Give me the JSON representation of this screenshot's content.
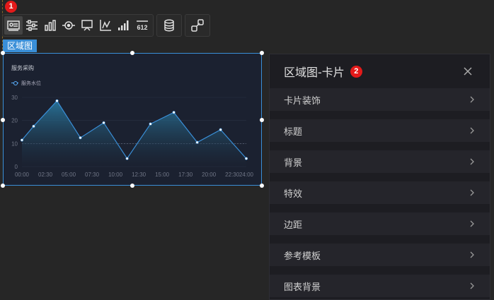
{
  "toolbar": {
    "groups": [
      [
        "image-chart-icon",
        "sliders-icon",
        "bar-chart-icon",
        "target-icon",
        "flag-icon",
        "axis-icon",
        "signal-bars-icon",
        "number-icon"
      ],
      [
        "database-icon"
      ],
      [
        "link-icon"
      ]
    ],
    "number_icon_text": "612"
  },
  "badges": {
    "one": "1",
    "two": "2"
  },
  "component_label": "区域图",
  "widget": {
    "title": "服务采购",
    "legend": "服务水位"
  },
  "chart_data": {
    "type": "area",
    "x": [
      "00:00",
      "02:30",
      "05:00",
      "07:30",
      "10:00",
      "12:30",
      "15:00",
      "17:30",
      "20:00",
      "22:30",
      "24:00"
    ],
    "points": [
      {
        "x": "00:00",
        "y": 11.5
      },
      {
        "x": "01:15",
        "y": 17.5
      },
      {
        "x": "03:45",
        "y": 28.5
      },
      {
        "x": "06:15",
        "y": 12.5
      },
      {
        "x": "08:45",
        "y": 19
      },
      {
        "x": "11:15",
        "y": 3.5
      },
      {
        "x": "13:45",
        "y": 18.5
      },
      {
        "x": "16:15",
        "y": 23.5
      },
      {
        "x": "18:45",
        "y": 10.5
      },
      {
        "x": "21:15",
        "y": 16
      },
      {
        "x": "24:00",
        "y": 3.5
      }
    ],
    "y_ticks": [
      0,
      10,
      20,
      30
    ],
    "ylim": [
      0,
      30
    ],
    "reference_line": 10,
    "colors": {
      "line": "#3a8fd8",
      "area_top": "#2a6fa0",
      "area_bottom": "#1b2130"
    }
  },
  "panel": {
    "title": "区域图-卡片",
    "rows": [
      "卡片装饰",
      "标题",
      "背景",
      "特效",
      "边距",
      "参考模板",
      "图表背景"
    ]
  }
}
